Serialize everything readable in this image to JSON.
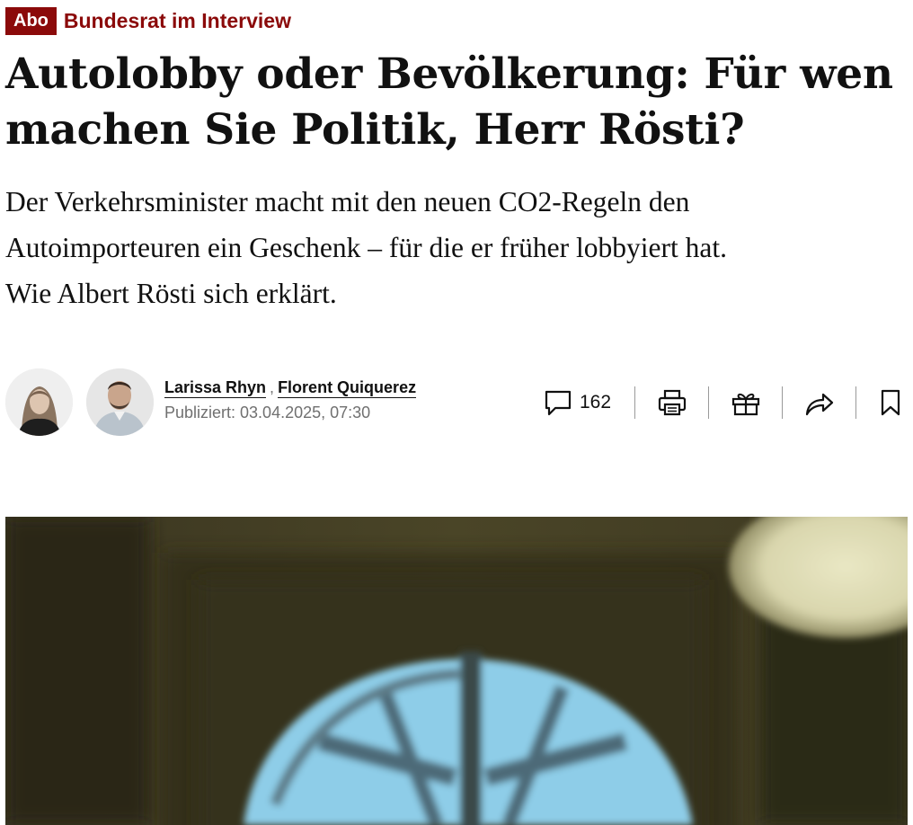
{
  "article": {
    "badge": "Abo",
    "kicker": "Bundesrat im Interview",
    "headline_line1": "Autolobby oder Bevölkerung: Für wen",
    "headline_line2": "machen Sie Politik, Herr Rösti?",
    "lead_line1": "Der Verkehrsminister macht mit den neuen CO2-Regeln den",
    "lead_line2": "Autoimporteuren ein Geschenk – für die er früher lobbyiert hat.",
    "lead_line3": "Wie Albert Rösti sich erklärt."
  },
  "byline": {
    "authors": [
      {
        "name": "Larissa Rhyn"
      },
      {
        "name": "Florent Quiquerez"
      }
    ],
    "separator": ",",
    "published": "Publiziert: 03.04.2025, 07:30"
  },
  "toolbar": {
    "comment_count": "162",
    "icons": [
      "comment-icon",
      "print-icon",
      "gift-icon",
      "share-icon",
      "bookmark-icon"
    ]
  },
  "colors": {
    "accent": "#8b0a0a",
    "text": "#111111",
    "muted": "#707070"
  }
}
